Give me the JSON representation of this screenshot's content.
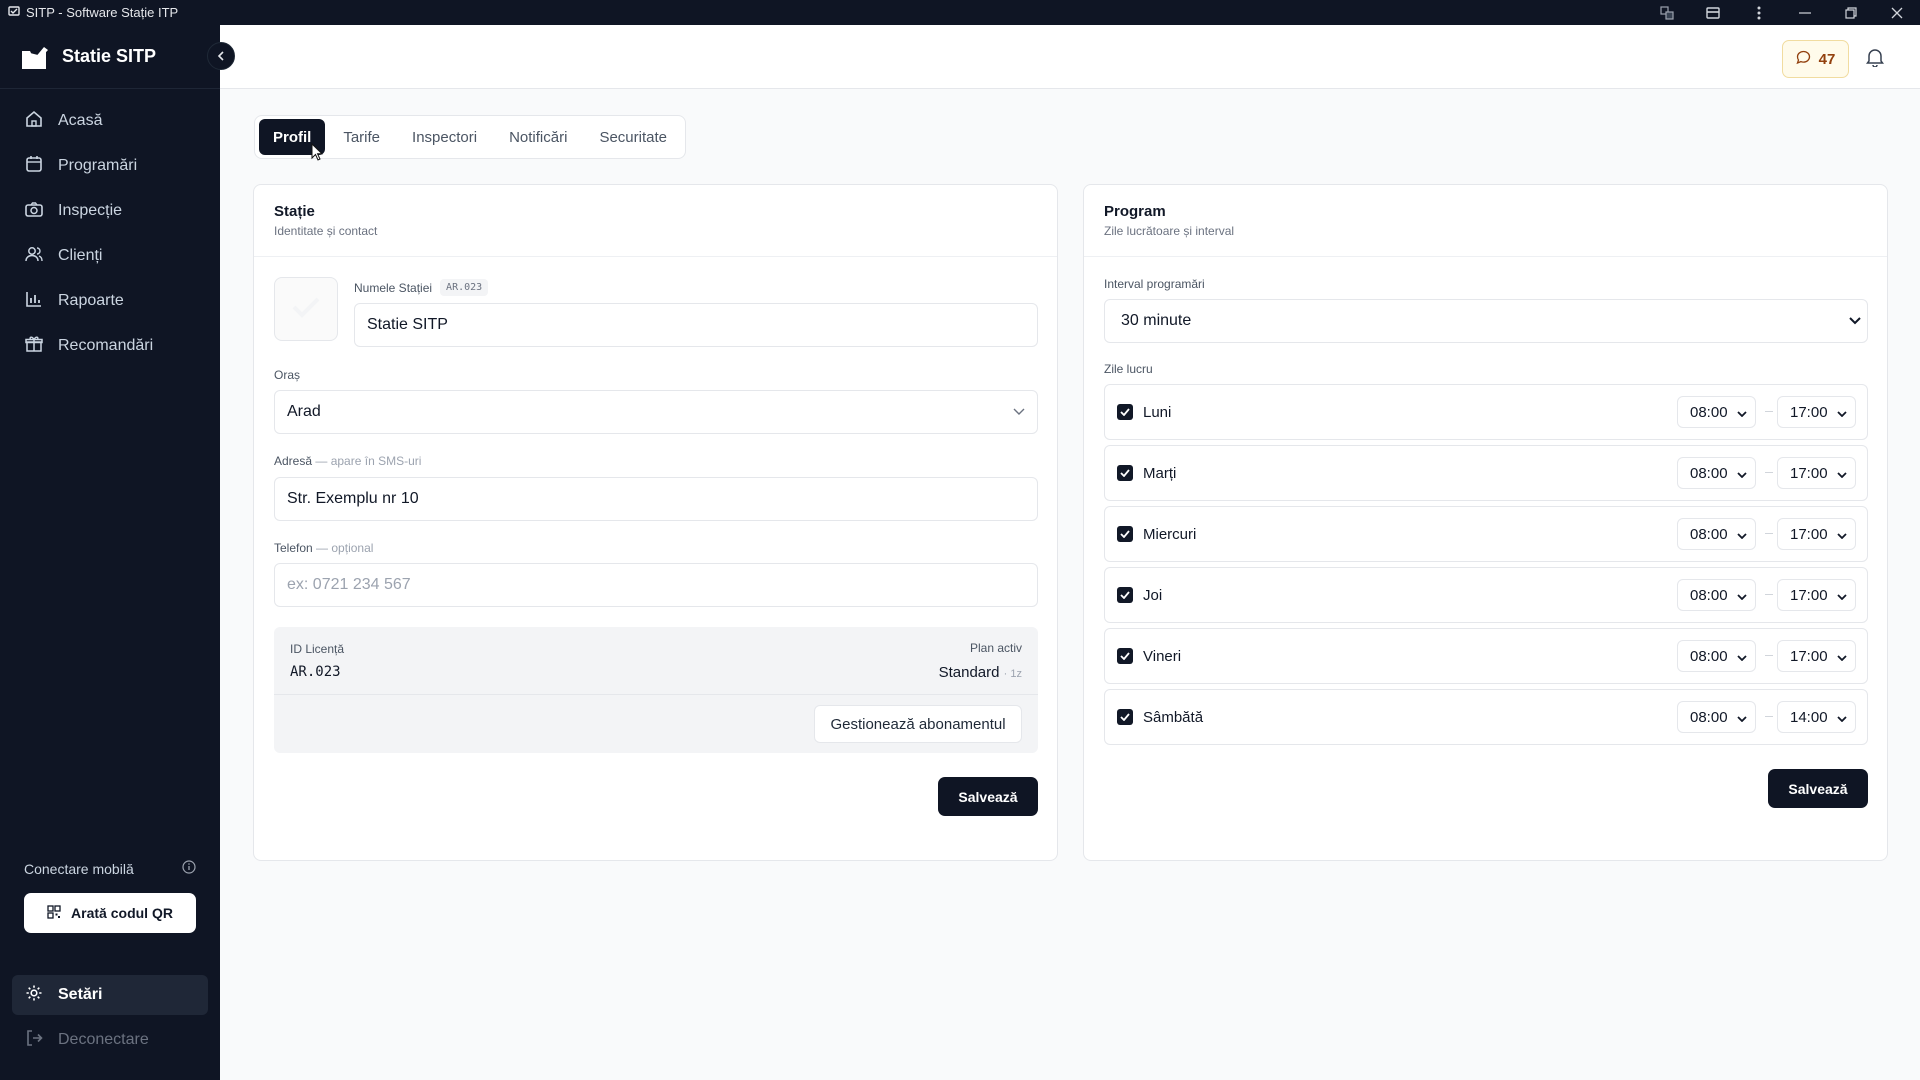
{
  "window": {
    "title": "SITP - Software Stație ITP"
  },
  "sidebar": {
    "brand": "Statie SITP",
    "items": [
      {
        "label": "Acasă",
        "icon": "home-icon"
      },
      {
        "label": "Programări",
        "icon": "calendar-icon"
      },
      {
        "label": "Inspecție",
        "icon": "camera-icon"
      },
      {
        "label": "Clienți",
        "icon": "users-icon"
      },
      {
        "label": "Rapoarte",
        "icon": "bar-chart-icon"
      },
      {
        "label": "Recomandări",
        "icon": "gift-icon"
      }
    ],
    "mobile_label": "Conectare mobilă",
    "qr_button": "Arată codul QR",
    "settings": "Setări",
    "logout": "Deconectare"
  },
  "topbar": {
    "messages_count": "47"
  },
  "tabs": [
    "Profil",
    "Tarife",
    "Inspectori",
    "Notificări",
    "Securitate"
  ],
  "station": {
    "title": "Stație",
    "subtitle": "Identitate și contact",
    "name_label": "Numele Stației",
    "name_code": "AR.023",
    "name_value": "Statie SITP",
    "city_label": "Oraș",
    "city_value": "Arad",
    "address_label": "Adresă",
    "address_hint": "— apare în SMS-uri",
    "address_value": "Str. Exemplu nr 10",
    "phone_label": "Telefon",
    "phone_hint": "— opțional",
    "phone_placeholder": "ex: 0721 234 567",
    "license_label": "ID Licență",
    "license_value": "AR.023",
    "plan_label": "Plan activ",
    "plan_value": "Standard",
    "plan_suffix": "· 1z",
    "manage_button": "Gestionează abonamentul",
    "save_button": "Salvează"
  },
  "program": {
    "title": "Program",
    "subtitle": "Zile lucrătoare și interval",
    "interval_label": "Interval programări",
    "interval_value": "30 minute",
    "days_label": "Zile lucru",
    "days": [
      {
        "name": "Luni",
        "start": "08:00",
        "end": "17:00",
        "checked": true
      },
      {
        "name": "Marți",
        "start": "08:00",
        "end": "17:00",
        "checked": true
      },
      {
        "name": "Miercuri",
        "start": "08:00",
        "end": "17:00",
        "checked": true
      },
      {
        "name": "Joi",
        "start": "08:00",
        "end": "17:00",
        "checked": true
      },
      {
        "name": "Vineri",
        "start": "08:00",
        "end": "17:00",
        "checked": true
      },
      {
        "name": "Sâmbătă",
        "start": "08:00",
        "end": "14:00",
        "checked": true
      }
    ],
    "save_button": "Salvează"
  }
}
